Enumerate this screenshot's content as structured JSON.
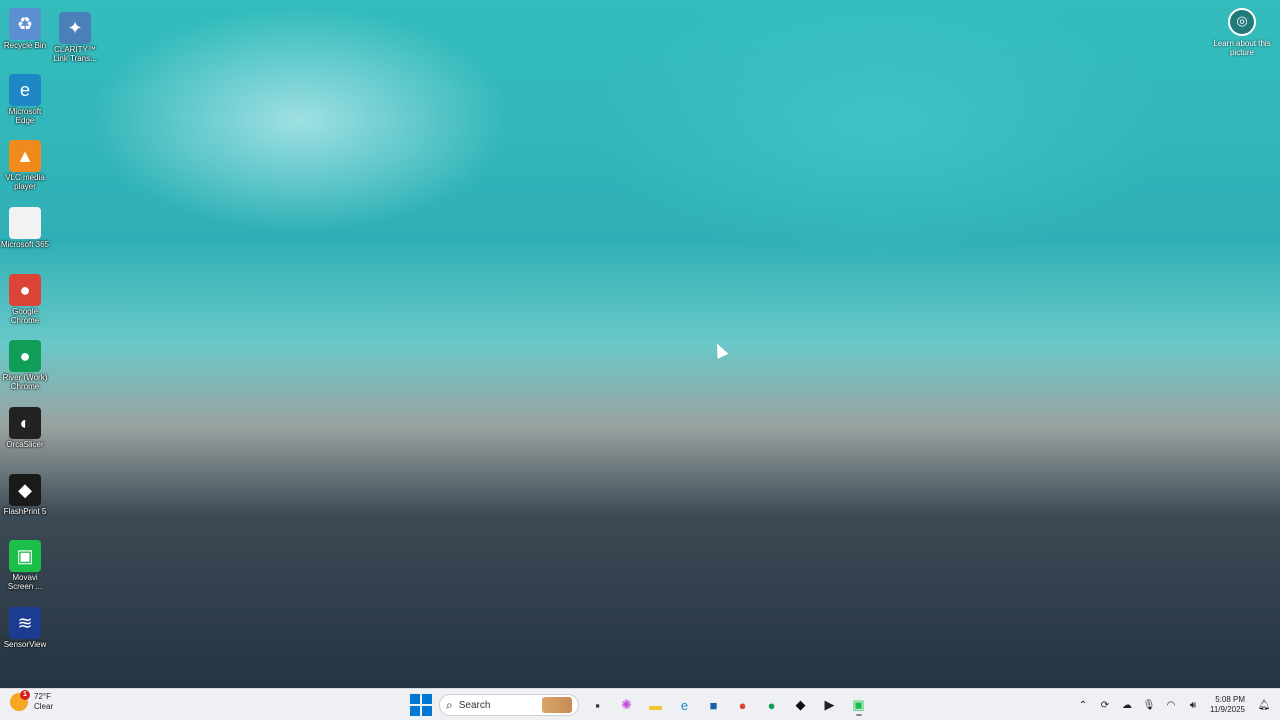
{
  "desktop": {
    "icons": [
      {
        "label": "Recycle Bin",
        "icon": "recycle-bin-icon",
        "color": "#5b8fd1",
        "glyph": "♻"
      },
      {
        "label": "CLARITY™ Link Trans...",
        "icon": "clarity-link-icon",
        "color": "#4a7fb8",
        "glyph": "✦"
      },
      {
        "label": "Microsoft Edge",
        "icon": "edge-icon",
        "color": "#1e88c7",
        "glyph": "e"
      },
      {
        "label": "VLC media player",
        "icon": "vlc-icon",
        "color": "#f08a1c",
        "glyph": "▲"
      },
      {
        "label": "Microsoft 365",
        "icon": "file-icon",
        "color": "#f2f2f2",
        "glyph": ""
      },
      {
        "label": "Google Chrome",
        "icon": "chrome-icon",
        "color": "#db4437",
        "glyph": "●"
      },
      {
        "label": "River (Work) Chrome",
        "icon": "chrome-work-icon",
        "color": "#0f9d58",
        "glyph": "●"
      },
      {
        "label": "OrcaSlicer",
        "icon": "orcaslicer-icon",
        "color": "#222222",
        "glyph": "◐"
      },
      {
        "label": "FlashPrint 5",
        "icon": "flashprint-icon",
        "color": "#1a1a1a",
        "glyph": "◆"
      },
      {
        "label": "Movavi Screen ...",
        "icon": "movavi-icon",
        "color": "#1dbf4b",
        "glyph": "▣"
      },
      {
        "label": "SensorView",
        "icon": "sensorview-icon",
        "color": "#1c3d8f",
        "glyph": "≋"
      }
    ],
    "learn_picture": {
      "label": "Learn about this picture",
      "icon": "camera-icon"
    }
  },
  "taskbar": {
    "weather": {
      "temp": "72°F",
      "condition": "Clear",
      "alert_count": "1"
    },
    "search": {
      "placeholder": "Search"
    },
    "apps": [
      {
        "name": "task-view-icon",
        "glyph": "▪",
        "color": "#333333"
      },
      {
        "name": "copilot-icon",
        "glyph": "✺",
        "color": "#c34fd8"
      },
      {
        "name": "file-explorer-icon",
        "glyph": "▬",
        "color": "#f4c430"
      },
      {
        "name": "edge-taskbar-icon",
        "glyph": "e",
        "color": "#1e88c7"
      },
      {
        "name": "store-icon",
        "glyph": "■",
        "color": "#1b5fa8"
      },
      {
        "name": "chrome-taskbar-icon",
        "glyph": "●",
        "color": "#db4437"
      },
      {
        "name": "chrome-work-taskbar-icon",
        "glyph": "●",
        "color": "#0f9d58"
      },
      {
        "name": "flashprint-taskbar-icon",
        "glyph": "◆",
        "color": "#111111"
      },
      {
        "name": "media-player-icon",
        "glyph": "▶",
        "color": "#222222"
      },
      {
        "name": "movavi-taskbar-icon",
        "glyph": "▣",
        "color": "#1dbf4b"
      }
    ],
    "tray": [
      "chevron-up-icon",
      "sync-icon",
      "cloud-icon",
      "microphone-icon",
      "wifi-icon",
      "volume-icon"
    ],
    "clock": {
      "time": "5:08 PM",
      "date": "11/9/2025"
    }
  }
}
